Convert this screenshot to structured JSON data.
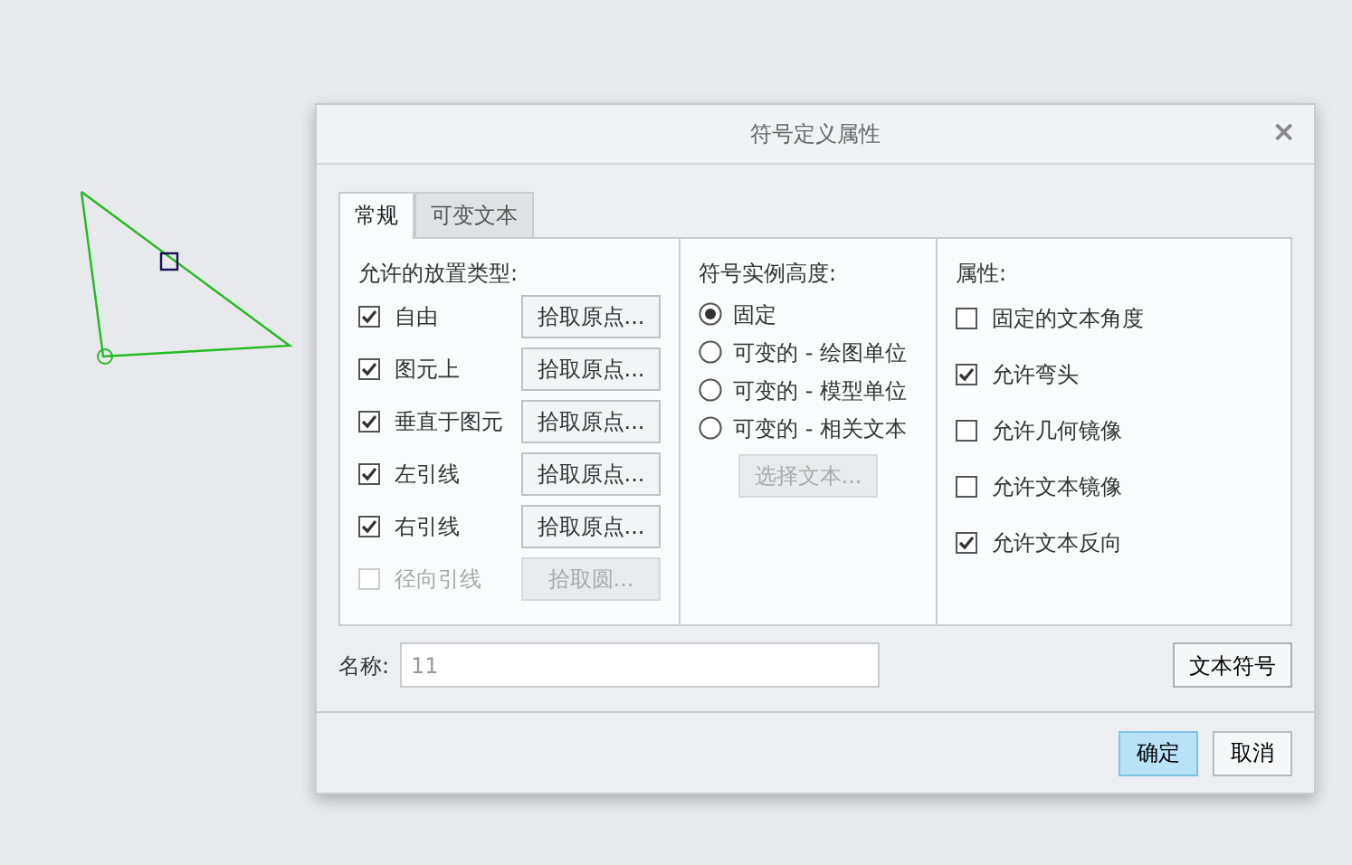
{
  "dialog": {
    "title": "符号定义属性",
    "close": "×"
  },
  "tabs": [
    {
      "label": "常规",
      "selected": true
    },
    {
      "label": "可变文本",
      "selected": false
    }
  ],
  "placement": {
    "heading": "允许的放置类型:",
    "rows": [
      {
        "label": "自由",
        "checked": true,
        "disabled": false,
        "button": "拾取原点..."
      },
      {
        "label": "图元上",
        "checked": true,
        "disabled": false,
        "button": "拾取原点..."
      },
      {
        "label": "垂直于图元",
        "checked": true,
        "disabled": false,
        "button": "拾取原点..."
      },
      {
        "label": "左引线",
        "checked": true,
        "disabled": false,
        "button": "拾取原点..."
      },
      {
        "label": "右引线",
        "checked": true,
        "disabled": false,
        "button": "拾取原点..."
      },
      {
        "label": "径向引线",
        "checked": false,
        "disabled": true,
        "button": "拾取圆..."
      }
    ]
  },
  "height": {
    "heading": "符号实例高度:",
    "options": [
      {
        "label": "固定",
        "selected": true
      },
      {
        "label": "可变的 - 绘图单位",
        "selected": false
      },
      {
        "label": "可变的 - 模型单位",
        "selected": false
      },
      {
        "label": "可变的 - 相关文本",
        "selected": false
      }
    ],
    "select_text_button": {
      "label": "选择文本...",
      "disabled": true
    }
  },
  "properties": {
    "heading": "属性:",
    "items": [
      {
        "label": "固定的文本角度",
        "checked": false
      },
      {
        "label": "允许弯头",
        "checked": true
      },
      {
        "label": "允许几何镜像",
        "checked": false
      },
      {
        "label": "允许文本镜像",
        "checked": false
      },
      {
        "label": "允许文本反向",
        "checked": true
      }
    ]
  },
  "name": {
    "label": "名称:",
    "value": "11"
  },
  "text_symbol_button": "文本符号",
  "buttons": [
    {
      "label": "确定",
      "default": true
    },
    {
      "label": "取消",
      "default": false
    }
  ]
}
